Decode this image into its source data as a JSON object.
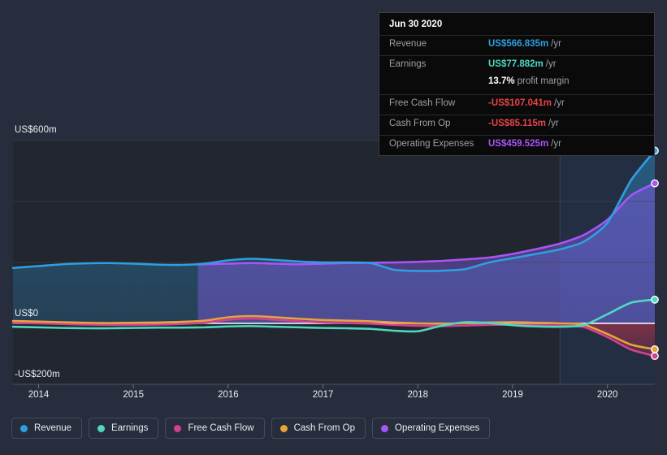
{
  "chart_data": {
    "type": "area",
    "title": "",
    "xlabel": "",
    "ylabel": "",
    "currency_unit": "US$ millions",
    "ylim": [
      -300,
      640
    ],
    "grid": true,
    "legend_position": "bottom",
    "y_ticks": [
      {
        "value": 600,
        "label": "US$600m"
      },
      {
        "value": 400,
        "label": ""
      },
      {
        "value": 200,
        "label": ""
      },
      {
        "value": 0,
        "label": "US$0"
      },
      {
        "value": -200,
        "label": "-US$200m"
      }
    ],
    "x_ticks": [
      "2014",
      "2015",
      "2016",
      "2017",
      "2018",
      "2019",
      "2020"
    ],
    "x_range": [
      2013.73,
      2020.5
    ],
    "highlight_band": {
      "from": 2019.5,
      "to": 2020.5,
      "label": ""
    },
    "series": [
      {
        "name": "Revenue",
        "color": "#2e9fe0",
        "x": [
          2013.73,
          2014.0,
          2014.25,
          2014.5,
          2014.75,
          2015.0,
          2015.25,
          2015.5,
          2015.75,
          2016.0,
          2016.25,
          2016.5,
          2016.75,
          2017.0,
          2017.25,
          2017.5,
          2017.75,
          2018.0,
          2018.25,
          2018.5,
          2018.75,
          2019.0,
          2019.25,
          2019.5,
          2019.75,
          2020.0,
          2020.25,
          2020.5
        ],
        "values": [
          182,
          188,
          194,
          197,
          198,
          196,
          193,
          192,
          196,
          207,
          212,
          208,
          203,
          200,
          200,
          198,
          176,
          172,
          173,
          178,
          200,
          214,
          228,
          243,
          268,
          330,
          470,
          566.835
        ]
      },
      {
        "name": "Earnings",
        "color": "#4fd8c0",
        "x": [
          2013.73,
          2014.0,
          2014.25,
          2014.5,
          2014.75,
          2015.0,
          2015.25,
          2015.5,
          2015.75,
          2016.0,
          2016.25,
          2016.5,
          2016.75,
          2017.0,
          2017.25,
          2017.5,
          2017.75,
          2018.0,
          2018.25,
          2018.5,
          2018.75,
          2019.0,
          2019.25,
          2019.5,
          2019.75,
          2020.0,
          2020.25,
          2020.5
        ],
        "values": [
          -11,
          -13,
          -15,
          -16,
          -16,
          -15,
          -14,
          -14,
          -13,
          -10,
          -9,
          -11,
          -13,
          -15,
          -16,
          -18,
          -24,
          -26,
          -8,
          4,
          1,
          -6,
          -10,
          -11,
          -6,
          30,
          68,
          77.882
        ]
      },
      {
        "name": "Free Cash Flow",
        "color": "#d1418f",
        "x": [
          2013.73,
          2014.0,
          2014.25,
          2014.5,
          2014.75,
          2015.0,
          2015.25,
          2015.5,
          2015.75,
          2016.0,
          2016.25,
          2016.5,
          2016.75,
          2017.0,
          2017.25,
          2017.5,
          2017.75,
          2018.0,
          2018.25,
          2018.5,
          2018.75,
          2019.0,
          2019.25,
          2019.5,
          2019.75,
          2020.0,
          2020.25,
          2020.5
        ],
        "values": [
          2,
          0,
          -2,
          -4,
          -5,
          -5,
          -4,
          -2,
          2,
          12,
          16,
          12,
          7,
          3,
          1,
          -1,
          -5,
          -8,
          -9,
          -7,
          -5,
          -4,
          -6,
          -8,
          -12,
          -45,
          -86,
          -107.041
        ]
      },
      {
        "name": "Cash From Op",
        "color": "#e8a33d",
        "x": [
          2013.73,
          2014.0,
          2014.25,
          2014.5,
          2014.75,
          2015.0,
          2015.25,
          2015.5,
          2015.75,
          2016.0,
          2016.25,
          2016.5,
          2016.75,
          2017.0,
          2017.25,
          2017.5,
          2017.75,
          2018.0,
          2018.25,
          2018.5,
          2018.75,
          2019.0,
          2019.25,
          2019.5,
          2019.75,
          2020.0,
          2020.25,
          2020.5
        ],
        "values": [
          8,
          6,
          4,
          2,
          1,
          2,
          3,
          5,
          9,
          20,
          24,
          20,
          15,
          11,
          9,
          7,
          3,
          0,
          -1,
          1,
          3,
          4,
          2,
          0,
          -4,
          -35,
          -70,
          -85.115
        ]
      },
      {
        "name": "Operating Expenses",
        "color": "#a855f7",
        "x": [
          2015.68,
          2015.75,
          2016.0,
          2016.25,
          2016.5,
          2016.75,
          2017.0,
          2017.25,
          2017.5,
          2017.75,
          2018.0,
          2018.25,
          2018.5,
          2018.75,
          2019.0,
          2019.25,
          2019.5,
          2019.75,
          2020.0,
          2020.25,
          2020.5
        ],
        "values": [
          193,
          194,
          196,
          198,
          196,
          194,
          196,
          198,
          199,
          200,
          202,
          205,
          210,
          216,
          228,
          244,
          262,
          290,
          340,
          420,
          459.525
        ]
      }
    ]
  },
  "tooltip": {
    "date": "Jun 30 2020",
    "rows": [
      {
        "label": "Revenue",
        "value": "US$566.835m",
        "unit": "/yr",
        "value_class": "v-rev"
      },
      {
        "label": "Earnings",
        "value": "US$77.882m",
        "unit": "/yr",
        "value_class": "v-earn"
      },
      {
        "label": "",
        "value": "13.7%",
        "unit": "profit margin",
        "value_class": "v-pm"
      },
      {
        "label": "Free Cash Flow",
        "value": "-US$107.041m",
        "unit": "/yr",
        "value_class": "v-neg"
      },
      {
        "label": "Cash From Op",
        "value": "-US$85.115m",
        "unit": "/yr",
        "value_class": "v-neg"
      },
      {
        "label": "Operating Expenses",
        "value": "US$459.525m",
        "unit": "/yr",
        "value_class": "v-opex"
      }
    ]
  },
  "legend": {
    "items": [
      {
        "label": "Revenue",
        "color": "#2e9fe0"
      },
      {
        "label": "Earnings",
        "color": "#4fd8c0"
      },
      {
        "label": "Free Cash Flow",
        "color": "#d1418f"
      },
      {
        "label": "Cash From Op",
        "color": "#e8a33d"
      },
      {
        "label": "Operating Expenses",
        "color": "#a855f7"
      }
    ]
  },
  "theme": {
    "page_bg": "#272d3d",
    "plot_bg": "#22262f",
    "band_bg": "#1b2333",
    "gridline": "#3e4552",
    "zero_line": "#ffffff",
    "text": "#e9edf2",
    "muted_text": "#9aa0a8"
  }
}
